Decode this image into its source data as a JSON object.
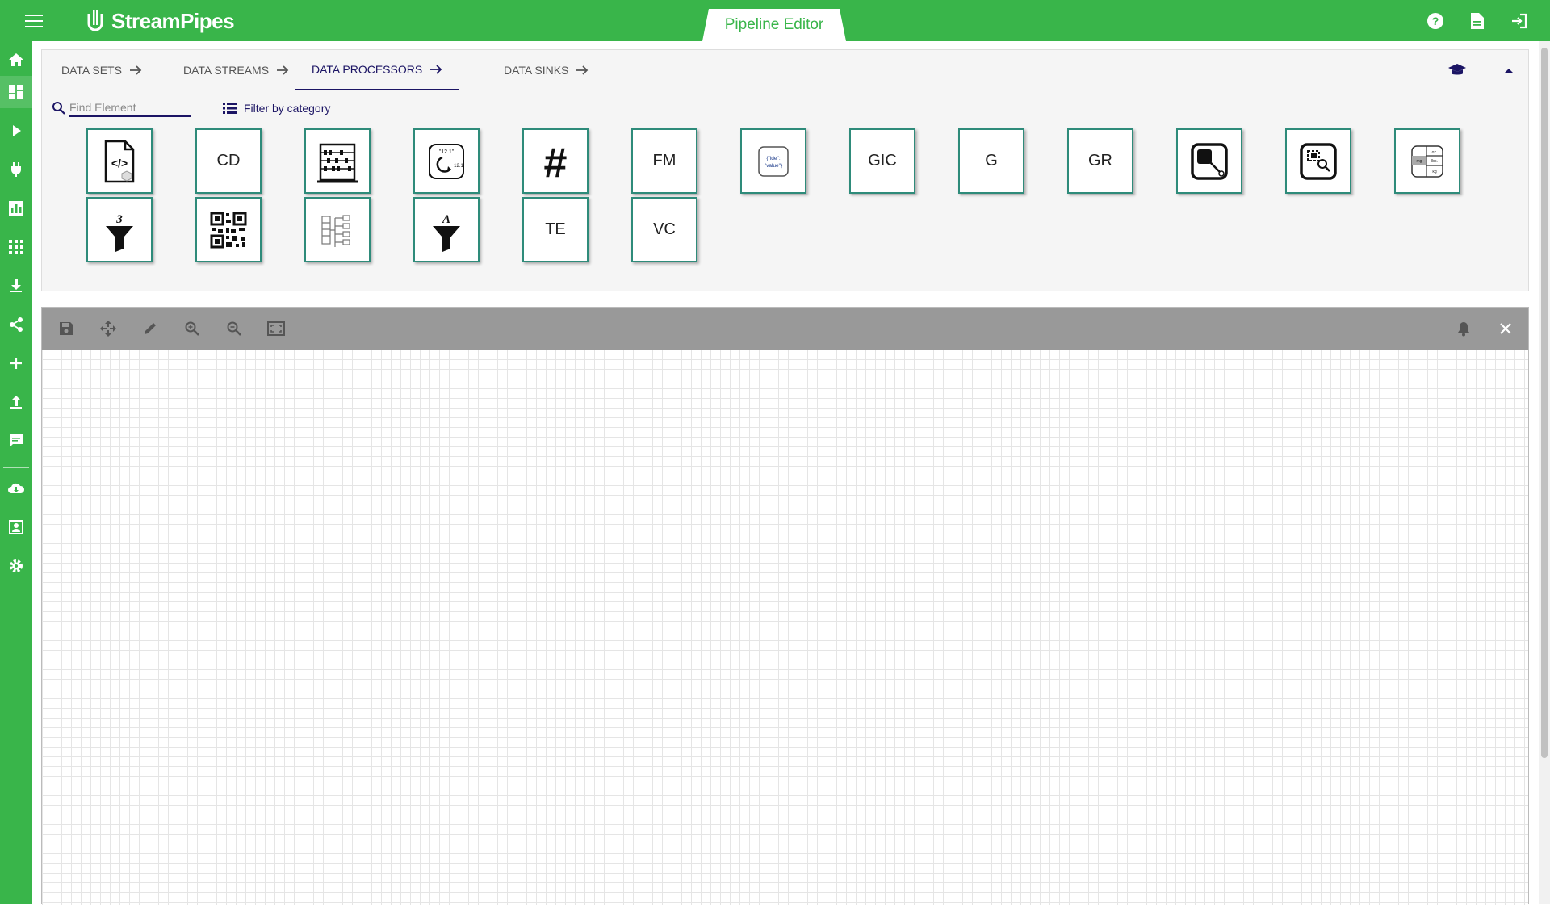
{
  "app": {
    "name": "StreamPipes",
    "editor_tab": "Pipeline Editor"
  },
  "top_actions": [
    {
      "icon": "help-icon"
    },
    {
      "icon": "document-icon"
    },
    {
      "icon": "logout-icon"
    }
  ],
  "sidebar": {
    "items": [
      {
        "icon": "home-icon"
      },
      {
        "icon": "dashboard-icon",
        "active": true
      },
      {
        "icon": "play-icon"
      },
      {
        "icon": "plug-icon"
      },
      {
        "icon": "chart-icon"
      },
      {
        "icon": "apps-grid-icon"
      },
      {
        "icon": "download-icon"
      },
      {
        "icon": "share-icon"
      },
      {
        "icon": "add-icon"
      },
      {
        "icon": "upload-icon"
      },
      {
        "icon": "notifications-icon"
      },
      {
        "icon": "cloud-download-icon"
      },
      {
        "icon": "profile-icon"
      },
      {
        "icon": "settings-icon"
      }
    ]
  },
  "tabs": [
    {
      "label": "DATA SETS"
    },
    {
      "label": "DATA STREAMS"
    },
    {
      "label": "DATA PROCESSORS",
      "active": true
    },
    {
      "label": "DATA SINKS"
    }
  ],
  "search": {
    "placeholder": "Find Element"
  },
  "filter": {
    "label": "Filter by category"
  },
  "elements": [
    {
      "abbr": "",
      "icon": "code-document-icon"
    },
    {
      "abbr": "CD",
      "icon": ""
    },
    {
      "abbr": "",
      "icon": "abacus-icon"
    },
    {
      "abbr": "",
      "icon": "number-convert-icon"
    },
    {
      "abbr": "",
      "icon": "hash-icon"
    },
    {
      "abbr": "FM",
      "icon": ""
    },
    {
      "abbr": "",
      "icon": "json-key-value-icon"
    },
    {
      "abbr": "GIC",
      "icon": ""
    },
    {
      "abbr": "G",
      "icon": ""
    },
    {
      "abbr": "GR",
      "icon": ""
    },
    {
      "abbr": "",
      "icon": "image-crop-icon"
    },
    {
      "abbr": "",
      "icon": "image-search-icon"
    },
    {
      "abbr": "",
      "icon": "unit-table-icon"
    },
    {
      "abbr": "",
      "icon": "numeric-filter-icon"
    },
    {
      "abbr": "",
      "icon": "qr-code-icon"
    },
    {
      "abbr": "",
      "icon": "list-tree-icon"
    },
    {
      "abbr": "",
      "icon": "text-filter-icon"
    },
    {
      "abbr": "TE",
      "icon": ""
    },
    {
      "abbr": "VC",
      "icon": ""
    }
  ],
  "editor_toolbar": [
    {
      "icon": "save-icon"
    },
    {
      "icon": "pan-icon"
    },
    {
      "icon": "edit-icon"
    },
    {
      "icon": "zoom-in-icon"
    },
    {
      "icon": "zoom-out-icon"
    },
    {
      "icon": "fit-screen-icon"
    }
  ],
  "editor_toolbar_right": [
    {
      "icon": "bell-icon"
    },
    {
      "icon": "close-icon"
    }
  ],
  "colors": {
    "brand": "#39b54a",
    "accent": "#1b1464",
    "tile_border": "#2e8b7a"
  }
}
